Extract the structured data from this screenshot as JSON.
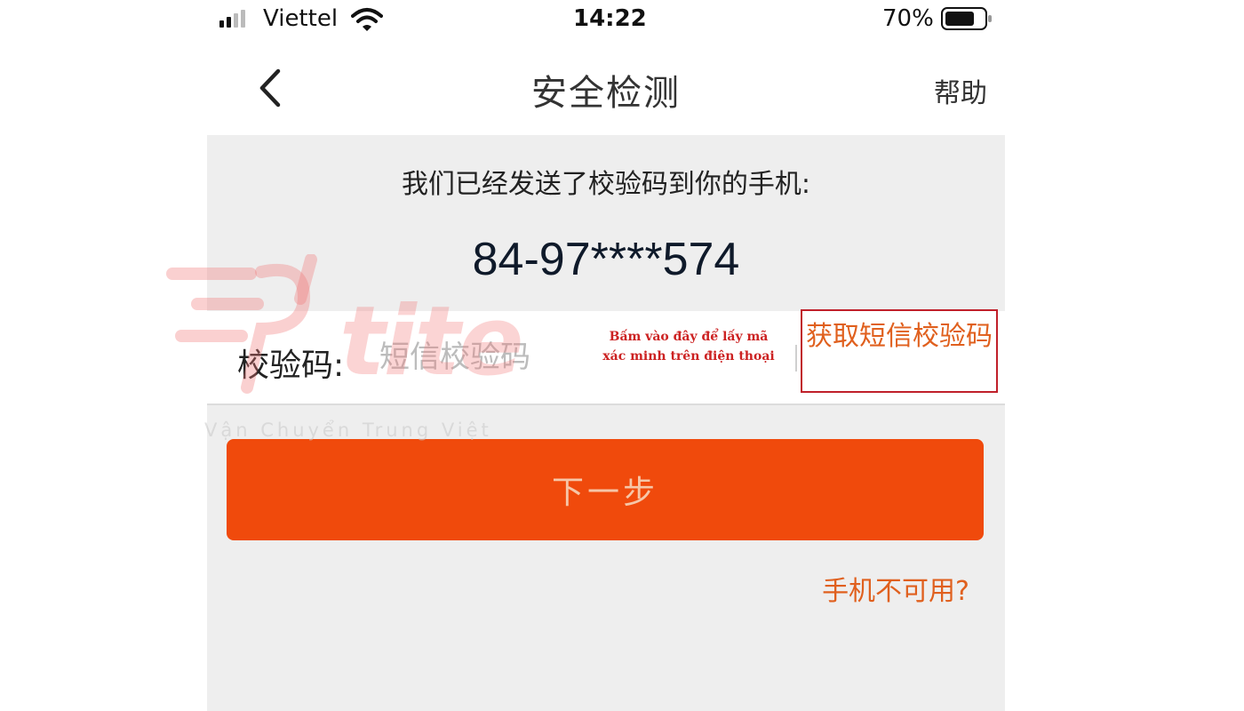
{
  "status_bar": {
    "carrier": "Viettel",
    "time": "14:22",
    "battery_percent": "70%",
    "signal_icon": "signal-bars-icon",
    "wifi_icon": "wifi-icon",
    "battery_icon": "battery-icon"
  },
  "nav": {
    "back_icon": "chevron-left-icon",
    "title": "安全检测",
    "help_label": "帮助"
  },
  "content": {
    "sent_message": "我们已经发送了校验码到你的手机:",
    "phone_number": "84-97****574",
    "code_label": "校验码:",
    "code_placeholder": "短信校验码",
    "code_value": "",
    "annotation_line1": "Bấm vào đây để lấy mã",
    "annotation_line2": "xác minh trên điện thoại",
    "get_code_label": "获取短信校验码",
    "next_button_label": "下一步",
    "phone_unavailable_link": "手机不可用?"
  },
  "watermark": {
    "logo_word": "tite",
    "tagline": "Vận Chuyển Trung Việt"
  },
  "colors": {
    "accent_orange": "#f04a0c",
    "link_orange": "#e0601e",
    "annotation_red": "#c0202a",
    "content_gray": "#eeeeee"
  }
}
